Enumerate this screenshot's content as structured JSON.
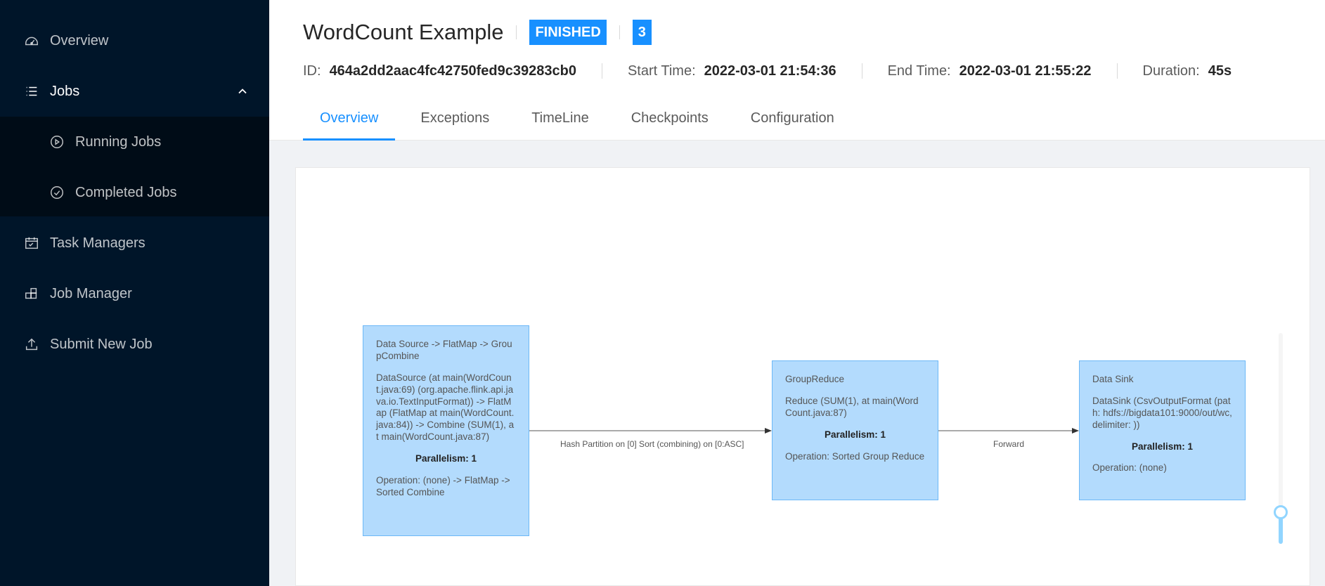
{
  "sidebar": {
    "items": [
      {
        "label": "Overview",
        "icon": "dashboard-icon"
      },
      {
        "label": "Jobs",
        "icon": "list-icon"
      },
      {
        "label": "Running Jobs",
        "icon": "play-circle-icon"
      },
      {
        "label": "Completed Jobs",
        "icon": "check-circle-icon"
      },
      {
        "label": "Task Managers",
        "icon": "calendar-icon"
      },
      {
        "label": "Job Manager",
        "icon": "build-icon"
      },
      {
        "label": "Submit New Job",
        "icon": "upload-icon"
      }
    ]
  },
  "header": {
    "title": "WordCount Example",
    "status": "FINISHED",
    "status_count": "3",
    "id_label": "ID:",
    "id_value": "464a2dd2aac4fc42750fed9c39283cb0",
    "start_label": "Start Time:",
    "start_value": "2022-03-01 21:54:36",
    "end_label": "End Time:",
    "end_value": "2022-03-01 21:55:22",
    "duration_label": "Duration:",
    "duration_value": "45s"
  },
  "tabs": [
    "Overview",
    "Exceptions",
    "TimeLine",
    "Checkpoints",
    "Configuration"
  ],
  "graph": {
    "nodes": [
      {
        "title": "Data Source -> FlatMap -> GroupCombine",
        "description": "DataSource (at main(WordCount.java:69) (org.apache.flink.api.java.io.TextInputFormat)) -> FlatMap (FlatMap at main(WordCount.java:84)) -> Combine (SUM(1), at main(WordCount.java:87)",
        "parallelism": "Parallelism: 1",
        "operation": "Operation: (none) -> FlatMap -> Sorted Combine"
      },
      {
        "title": "GroupReduce",
        "description": "Reduce (SUM(1), at main(WordCount.java:87)",
        "parallelism": "Parallelism: 1",
        "operation": "Operation: Sorted Group Reduce"
      },
      {
        "title": "Data Sink",
        "description": "DataSink (CsvOutputFormat (path: hdfs://bigdata101:9000/out/wc, delimiter: ))",
        "parallelism": "Parallelism: 1",
        "operation": "Operation: (none)"
      }
    ],
    "edges": [
      {
        "label": "Hash Partition on [0] Sort (combining) on [0:ASC]"
      },
      {
        "label": "Forward"
      }
    ]
  }
}
